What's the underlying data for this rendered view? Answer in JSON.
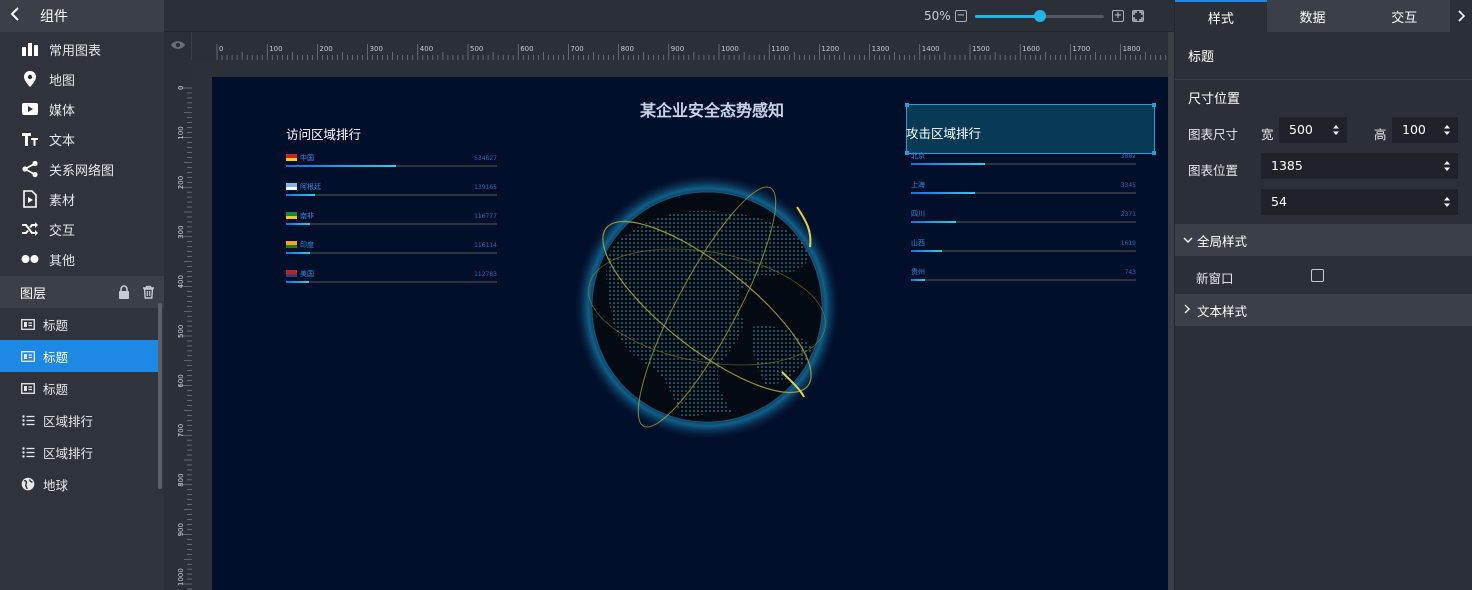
{
  "left": {
    "header_title": "组件",
    "components": [
      {
        "label": "常用图表",
        "icon": "bar-chart-icon"
      },
      {
        "label": "地图",
        "icon": "map-pin-icon"
      },
      {
        "label": "媒体",
        "icon": "play-icon"
      },
      {
        "label": "文本",
        "icon": "text-icon"
      },
      {
        "label": "关系网络图",
        "icon": "share-icon"
      },
      {
        "label": "素材",
        "icon": "material-icon"
      },
      {
        "label": "交互",
        "icon": "shuffle-icon"
      },
      {
        "label": "其他",
        "icon": "dots-icon"
      }
    ],
    "layers_title": "图层",
    "layers": [
      {
        "label": "标题",
        "icon": "title-layer-icon"
      },
      {
        "label": "标题",
        "icon": "title-layer-icon"
      },
      {
        "label": "标题",
        "icon": "title-layer-icon"
      },
      {
        "label": "区域排行",
        "icon": "list-icon"
      },
      {
        "label": "区域排行",
        "icon": "list-icon"
      },
      {
        "label": "地球",
        "icon": "globe-icon"
      }
    ],
    "active_layer_index": 1
  },
  "toolbar": {
    "zoom_label": "50%",
    "zoom_fraction": 0.5
  },
  "ruler": {
    "h_labels": [
      "0",
      "100",
      "200",
      "300",
      "400",
      "500",
      "600",
      "700",
      "800",
      "900",
      "1000",
      "1100",
      "1200",
      "1300",
      "1400",
      "1500",
      "1600",
      "1700",
      "1800"
    ],
    "v_labels": [
      "0",
      "100",
      "200",
      "300",
      "400",
      "500",
      "600",
      "700",
      "800",
      "900",
      "1000"
    ]
  },
  "screen": {
    "title": "某企业安全态势感知",
    "visit": {
      "title": "访问区域排行",
      "rows": [
        {
          "name": "中国",
          "value": "534827",
          "ratio": 1.0
        },
        {
          "name": "阿根廷",
          "value": "139165",
          "ratio": 0.26
        },
        {
          "name": "南非",
          "value": "116777",
          "ratio": 0.22
        },
        {
          "name": "印度",
          "value": "116114",
          "ratio": 0.22
        },
        {
          "name": "美国",
          "value": "112783",
          "ratio": 0.21
        }
      ]
    },
    "attack": {
      "title": "攻击区域排行",
      "rows": [
        {
          "name": "北京",
          "value": "3882",
          "ratio": 1.0
        },
        {
          "name": "上海",
          "value": "3345",
          "ratio": 0.86
        },
        {
          "name": "四川",
          "value": "2371",
          "ratio": 0.61
        },
        {
          "name": "山西",
          "value": "1619",
          "ratio": 0.42
        },
        {
          "name": "贵州",
          "value": "743",
          "ratio": 0.19
        }
      ]
    }
  },
  "right": {
    "tabs": [
      "样式",
      "数据",
      "交互"
    ],
    "active_tab": 0,
    "panel_title": "标题",
    "size_section": "尺寸位置",
    "chart_size_label": "图表尺寸",
    "width_label": "宽",
    "width_value": "500",
    "height_label": "高",
    "height_value": "100",
    "chart_pos_label": "图表位置",
    "pos_x": "1385",
    "pos_y": "54",
    "global_style": "全局样式",
    "new_window": "新窗口",
    "text_style": "文本样式"
  },
  "colors": {
    "accent": "#1e88e5",
    "screen_bg": "#020f2a",
    "bar_start": "#1d6ce0",
    "bar_end": "#24d0e8"
  }
}
